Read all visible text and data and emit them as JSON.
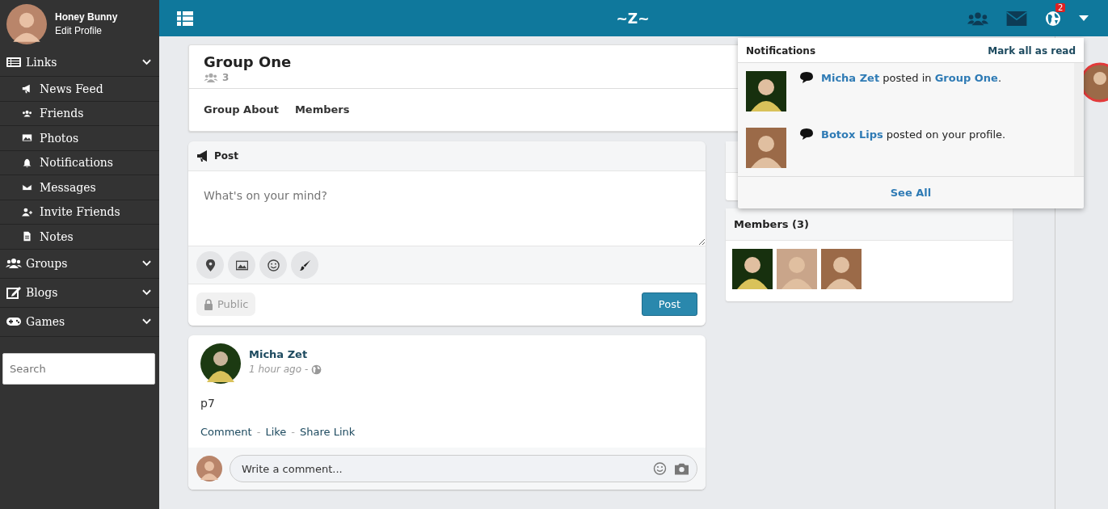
{
  "sidebar": {
    "profile": {
      "name": "Honey Bunny",
      "edit": "Edit Profile"
    },
    "menu": [
      {
        "label": "Links",
        "children": [
          "News Feed",
          "Friends",
          "Photos",
          "Notifications",
          "Messages",
          "Invite Friends",
          "Notes"
        ]
      },
      {
        "label": "Groups"
      },
      {
        "label": "Blogs"
      },
      {
        "label": "Games"
      }
    ],
    "search": {
      "placeholder": "Search"
    }
  },
  "topbar": {
    "title": "~Z~",
    "badge": "2"
  },
  "group": {
    "title": "Group One",
    "count": "3",
    "tabs": [
      "Group About",
      "Members"
    ]
  },
  "composer": {
    "heading": "Post",
    "placeholder": "What's on your mind?",
    "privacy": "Public",
    "submit": "Post"
  },
  "post": {
    "author": "Micha Zet",
    "time": "1 hour ago",
    "sep": "-",
    "body": "p7",
    "actions": [
      "Comment",
      "Like",
      "Share Link"
    ],
    "comment_placeholder": "Write a comment..."
  },
  "members_card": {
    "title": "Members (3)"
  },
  "notifications": {
    "title": "Notifications",
    "mark_all": "Mark all as read",
    "see_all": "See All",
    "items": [
      {
        "actor": "Micha Zet",
        "text": " posted in ",
        "target": "Group One",
        "end": "."
      },
      {
        "actor": "Botox Lips",
        "text": " posted on your profile."
      }
    ]
  }
}
